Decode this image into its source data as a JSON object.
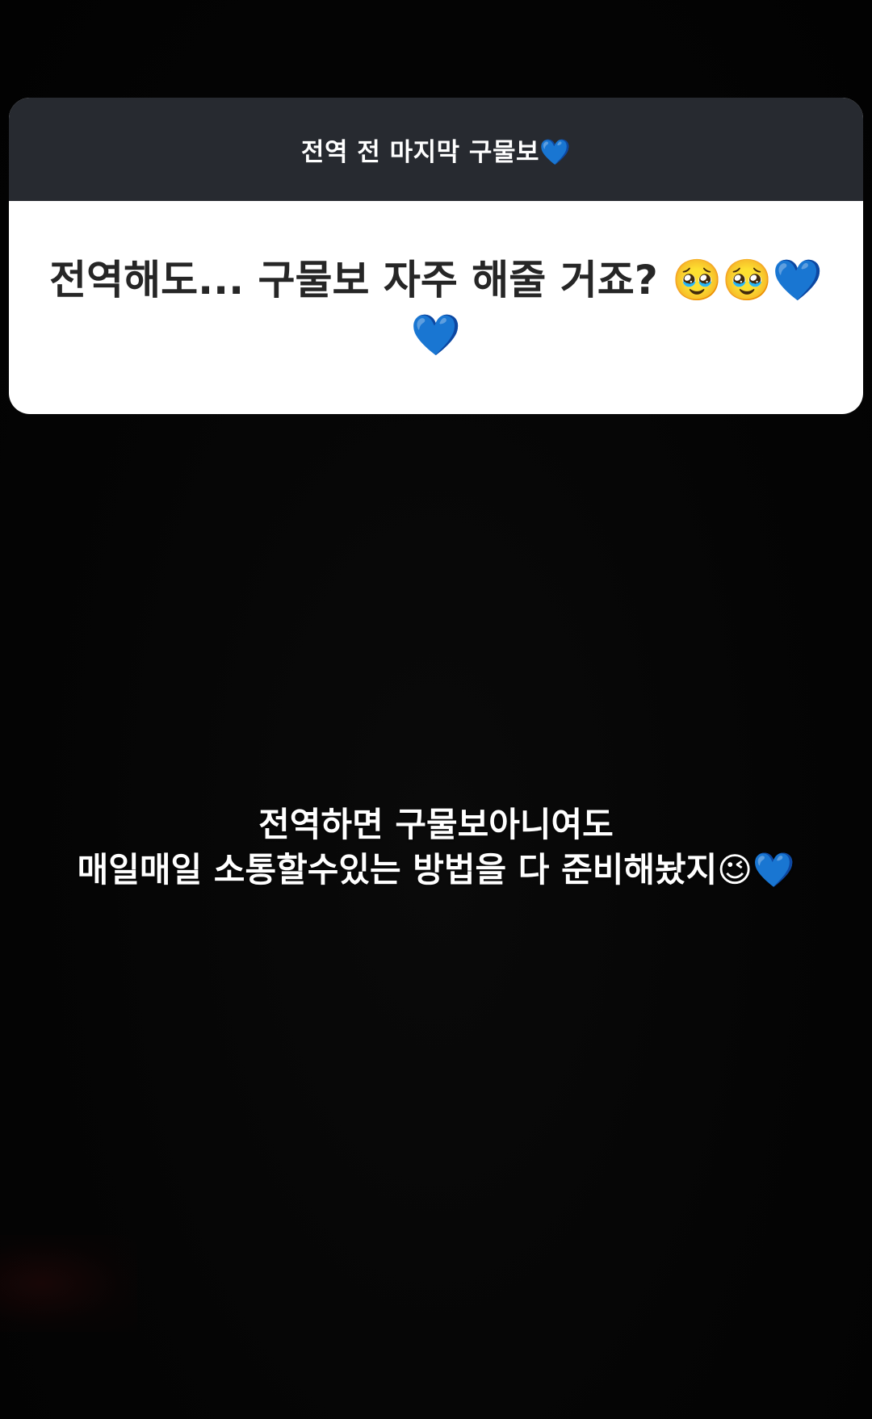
{
  "question_box": {
    "header": "전역 전 마지막 구물보💙",
    "question": "전역해도... 구물보 자주 해줄 거죠? 🥹🥹💙💙"
  },
  "answer": {
    "line1": "전역하면 구물보아니여도",
    "line2": "매일매일 소통할수있는 방법을 다 준비해놨지😉💙"
  },
  "colors": {
    "background": "#030303",
    "header_bg": "#272a30",
    "card_bg": "#ffffff",
    "question_text": "#262626",
    "answer_text": "#ffffff"
  }
}
